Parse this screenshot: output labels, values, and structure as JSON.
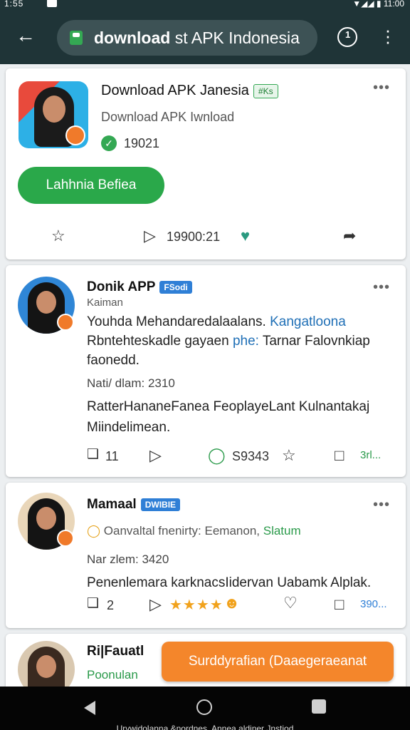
{
  "status": {
    "time": "1:55",
    "right": "▼◢◢ ▮ 11:00"
  },
  "browser": {
    "url_bold": "download",
    "url_rest": "st APK Indonesia",
    "tab_count": "1"
  },
  "app_card": {
    "title": "Download APK Janesia",
    "tag": "#Ks",
    "subtitle": "Download APK Iwnload",
    "count": "19021",
    "install_button": "Lahhnia Befiea",
    "share_count": "19900:21"
  },
  "posts": [
    {
      "name": "Donik APP",
      "tag": "FSodi",
      "role": "Kaiman",
      "text_a": "Youhda Mehandaredalaalans.",
      "text_link": "Kangatloona",
      "text_b": "Rbntehteskadle gayaen",
      "text_hl": "phe:",
      "text_c": "Tarnar Falovnkiap faonedd.",
      "meta": "Nati/ dlam: 2310",
      "text2": "RatterHananeFanea FeoplayeLant Kulnantakaj Miindelimean.",
      "comments": "11",
      "views": "S9343",
      "more_count": "3rl..."
    },
    {
      "name": "Mamaal",
      "tag": "DWIBIE",
      "role_a": "Oanvaltal fnenirty: Eemanon,",
      "role_b": "Slatum",
      "meta": "Nar zlem: 3420",
      "text2": "Penenlemara karknacsIidervan Uabamk Alplak.",
      "comments": "2",
      "stars": "★★★★",
      "more_count": "390..."
    },
    {
      "name": "Ri|Fauatl",
      "role": "Poonulan"
    }
  ],
  "floating_button": "Surddyrafian (Daaegeraeanat",
  "nav_caption": "Urvwidolanna &nordnes, Annea aldiner Jnstiod"
}
